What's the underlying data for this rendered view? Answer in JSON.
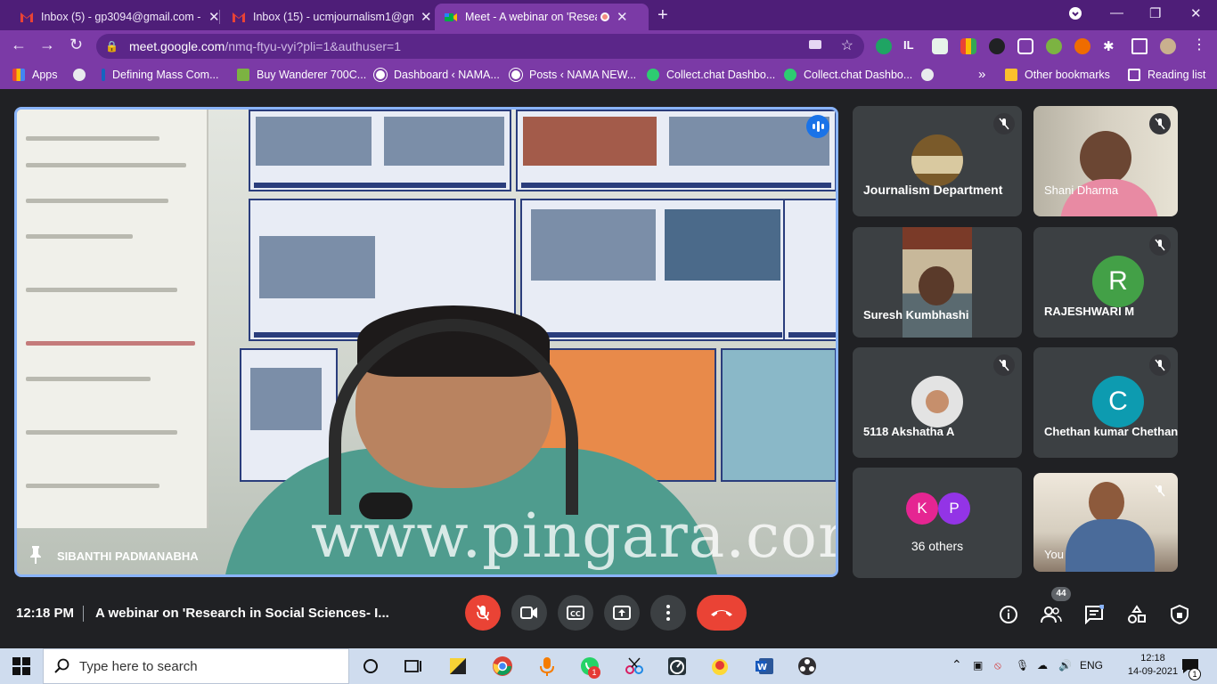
{
  "browser": {
    "tabs": [
      {
        "title": "Inbox (5) - gp3094@gmail.com -",
        "active": false
      },
      {
        "title": "Inbox (15) - ucmjournalism1@gm",
        "active": false
      },
      {
        "title": "Meet - A webinar on 'Research",
        "active": true
      }
    ],
    "url_host": "meet.google.com",
    "url_path": "/nmq-ftyu-vyi?pli=1&authuser=1",
    "bookmarks": [
      "Apps",
      "Defining Mass Com...",
      "Buy Wanderer 700C...",
      "Dashboard ‹ NAMA...",
      "Posts ‹ NAMA NEW...",
      "Collect.chat Dashbo...",
      "Collect.chat Dashbo..."
    ],
    "other_bookmarks": "Other bookmarks",
    "reading_list": "Reading list",
    "overflow": "»",
    "colors": {
      "frame": "#4e1e78",
      "toolbar": "#7b3aa6"
    }
  },
  "meet": {
    "main_speaker": "SIBANTHI PADMANABHA",
    "watermark": "www.pingara.com",
    "participants": [
      {
        "name": "Journalism Department",
        "type": "photo-avatar"
      },
      {
        "name": "Shani Dharma",
        "type": "video"
      },
      {
        "name": "Suresh Kumbhashi",
        "type": "video"
      },
      {
        "name": "RAJESHWARI M",
        "type": "initial",
        "initial": "R",
        "color": "#43a047"
      },
      {
        "name": "5118 Akshatha A",
        "type": "photo-avatar"
      },
      {
        "name": "Chethan kumar Chethan",
        "type": "initial",
        "initial": "C",
        "color": "#0d9bb0"
      },
      {
        "name": "You",
        "type": "video"
      }
    ],
    "others": {
      "initials": [
        "K",
        "P"
      ],
      "label": "36 others"
    },
    "time": "12:18 PM",
    "meeting_title": "A webinar on 'Research in Social Sciences- I...",
    "people_count": "44",
    "icons": [
      "mic-off-icon",
      "camera-icon",
      "captions-icon",
      "present-icon",
      "more-icon",
      "hangup-icon",
      "info-icon",
      "people-icon",
      "chat-icon",
      "activities-icon",
      "host-controls-icon"
    ]
  },
  "taskbar": {
    "search_placeholder": "Type here to search",
    "language": "ENG",
    "time": "12:18",
    "date": "14-09-2021",
    "whatsapp_badge": "1",
    "notifications": "1"
  }
}
